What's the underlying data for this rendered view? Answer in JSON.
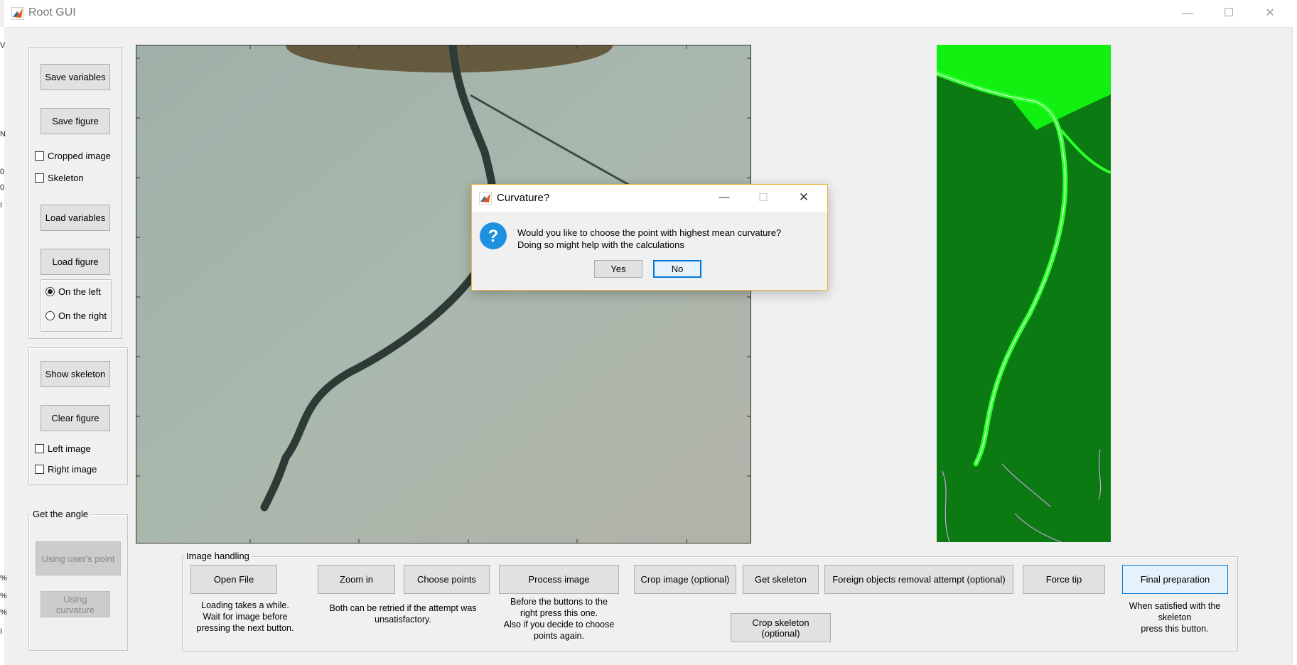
{
  "window": {
    "title": "Root GUI",
    "minimize_glyph": "—",
    "maximize_glyph": "☐",
    "close_glyph": "✕"
  },
  "left_strip": [
    "V",
    "N",
    "0",
    "0",
    "I",
    "%",
    "%",
    "%",
    "I"
  ],
  "panel1": {
    "save_variables": "Save variables",
    "save_figure": "Save figure",
    "cropped_image": "Cropped image",
    "skeleton": "Skeleton",
    "load_variables": "Load variables",
    "load_figure": "Load figure",
    "on_the_left": "On the left",
    "on_the_right": "On the right"
  },
  "panel2": {
    "show_skeleton": "Show skeleton",
    "clear_figure": "Clear figure",
    "left_image": "Left image",
    "right_image": "Right image"
  },
  "angle_panel": {
    "title": "Get the angle",
    "using_users_point": "Using user's point",
    "using_curvature": "Using curvature"
  },
  "image_handling": {
    "title": "Image handling",
    "open_file": "Open File",
    "zoom_in": "Zoom in",
    "choose_points": "Choose points",
    "process_image": "Process image",
    "crop_image": "Crop image (optional)",
    "get_skeleton": "Get skeleton",
    "foreign_objects": "Foreign objects removal attempt (optional)",
    "force_tip": "Force tip",
    "final_preparation": "Final preparation",
    "crop_skeleton": "Crop skeleton (optional)",
    "note_open": "Loading takes a while.\nWait for  image before\npressing the next button.",
    "note_zoom": "Both can be retried if the attempt was\nunsatisfactory.",
    "note_process": "Before the buttons to the\nright press this one.\nAlso if you decide to choose\npoints again.",
    "note_final": "When satisfied with the\nskeleton\npress this button."
  },
  "dialog": {
    "title": "Curvature?",
    "line1": "Would you like to choose the point with highest mean curvature?",
    "line2": "Doing so might help with the calculations",
    "yes": "Yes",
    "no": "No",
    "icon": "question-icon"
  },
  "colors": {
    "accent": "#0078d7",
    "dialog_border": "#f0b43c",
    "skeleton_green": "#00ff00"
  }
}
